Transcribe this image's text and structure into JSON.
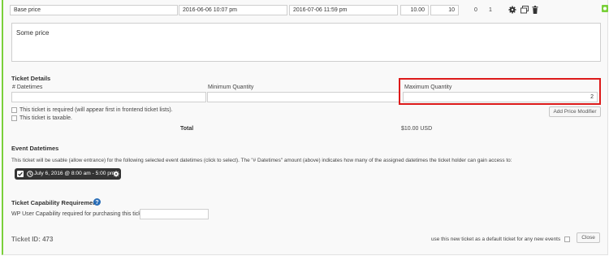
{
  "price_row": {
    "name_value": "Base price",
    "start_date": "2016-06-06 10:07 pm",
    "end_date": "2016-07-06 11:59 pm",
    "price": "10.00",
    "quantity": "10",
    "sold": "0",
    "datetimes_count": "1"
  },
  "description": {
    "value": "Some price"
  },
  "ticket_details": {
    "heading": "Ticket Details",
    "datetimes_label": "# Datetimes",
    "datetimes_value": "",
    "min_qty_label": "Minimum Quantity",
    "min_qty_value": "",
    "max_qty_label": "Maximum Quantity",
    "max_qty_value": "2",
    "required_label": "This ticket is required (will appear first in frontend ticket lists).",
    "taxable_label": "This ticket is taxable.",
    "add_price_modifier": "Add Price Modifier",
    "total_label": "Total",
    "total_value": "$10.00 USD"
  },
  "event_datetimes": {
    "heading": "Event Datetimes",
    "description": "This ticket will be usable (allow entrance) for the following selected event datetimes (click to select). The \"# Datetimes\" amount (above) indicates how many of the assigned datetimes the ticket holder can gain access to:",
    "chip_label": "July 6, 2016 @ 8:00 am - 5:00 pm"
  },
  "capability": {
    "heading": "Ticket Capability Requirement",
    "label": "WP User Capability required for purchasing this ticket:",
    "value": ""
  },
  "footer": {
    "ticket_id": "Ticket ID: 473",
    "default_label": "use this new ticket as a default ticket for any new events",
    "close_label": "Close"
  },
  "colors": {
    "accent_green": "#7ad03a",
    "highlight_red": "#dd1a1a",
    "chip_bg": "#333333"
  }
}
